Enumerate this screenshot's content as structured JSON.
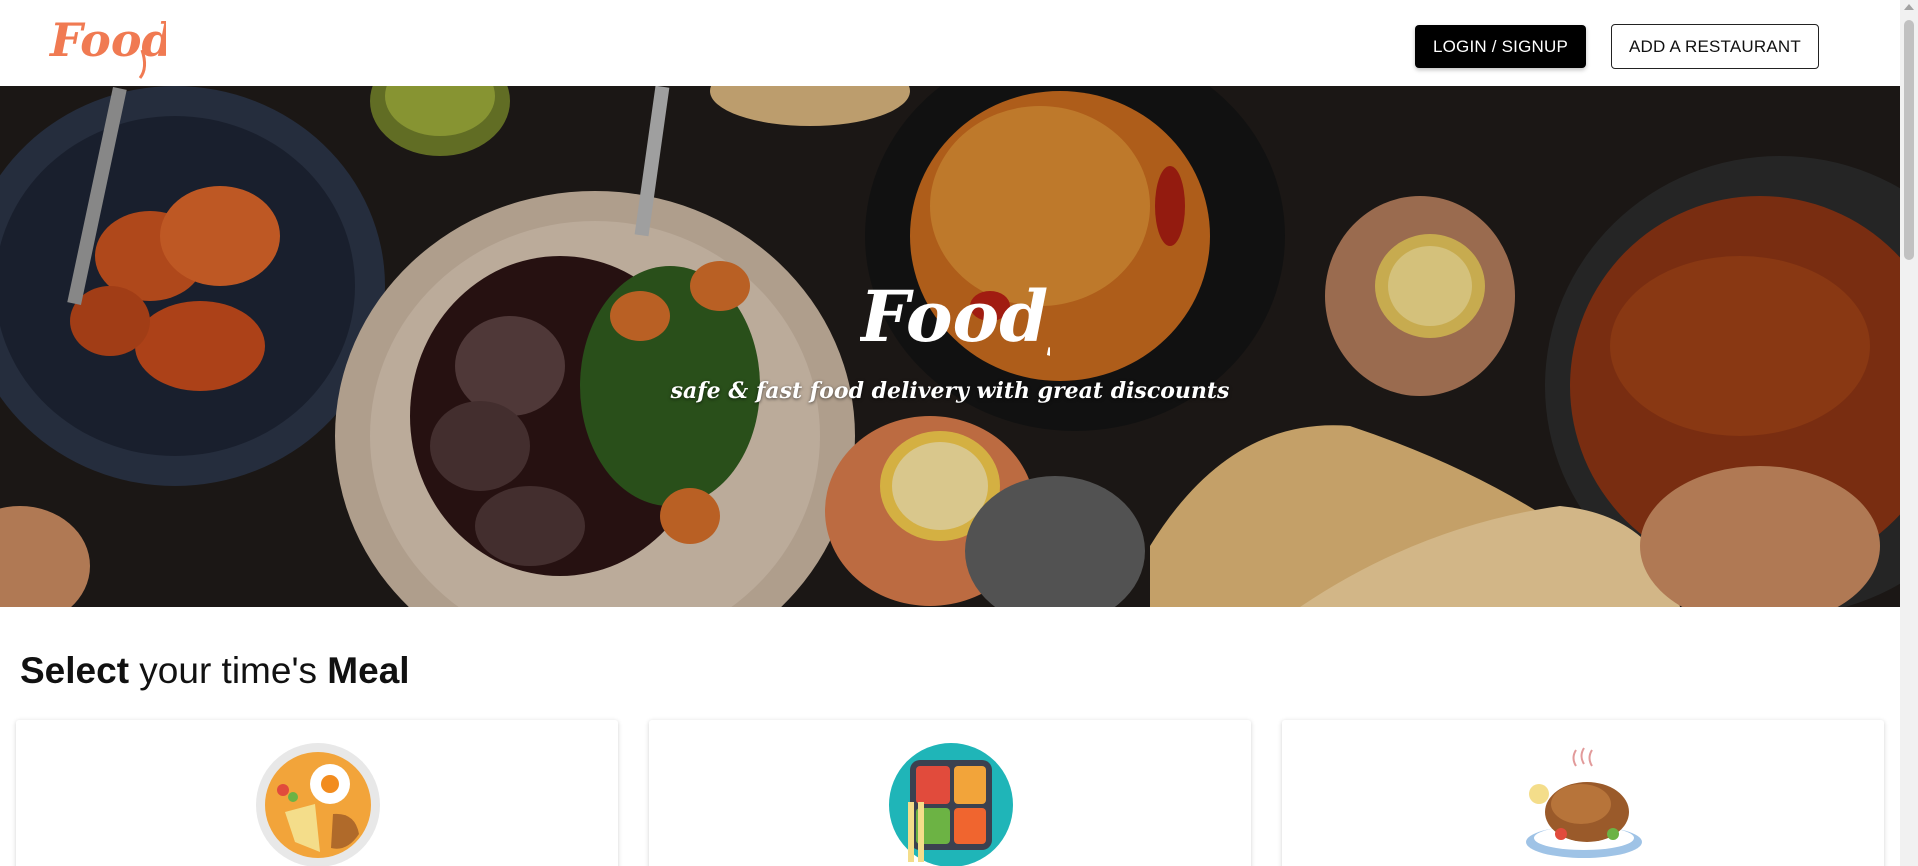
{
  "header": {
    "logo_text": "Foody",
    "login_label": "LOGIN / SIGNUP",
    "add_restaurant_label": "ADD A RESTAURANT"
  },
  "hero": {
    "title": "Foody",
    "tagline": "safe & fast food delivery with great discounts"
  },
  "section": {
    "heading_part1": "Select",
    "heading_part2": " your time's ",
    "heading_part3": "Meal"
  },
  "meal_cards": [
    {
      "icon": "breakfast-icon"
    },
    {
      "icon": "lunch-icon"
    },
    {
      "icon": "dinner-icon"
    }
  ],
  "colors": {
    "brand": "#f07a52",
    "login_bg": "#000000",
    "text": "#111111"
  }
}
